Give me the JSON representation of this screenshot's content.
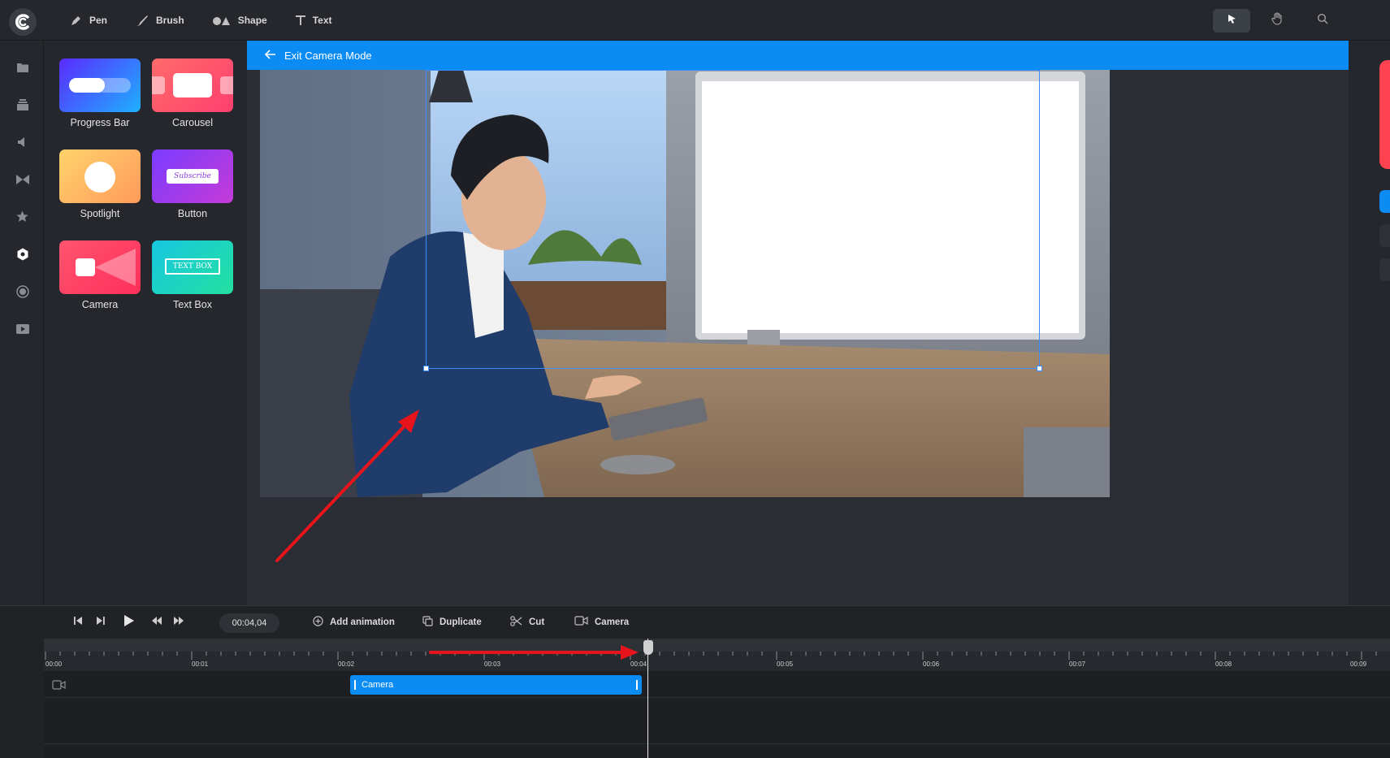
{
  "toolbar": {
    "tools": [
      {
        "label": "Pen",
        "icon": "pen-icon"
      },
      {
        "label": "Brush",
        "icon": "brush-icon"
      },
      {
        "label": "Shape",
        "icon": "shape-icon"
      },
      {
        "label": "Text",
        "icon": "text-icon"
      }
    ],
    "right_tools": [
      "select-icon",
      "hand-icon",
      "search-icon"
    ]
  },
  "rail": [
    "folder-icon",
    "layers-icon",
    "audio-icon",
    "transition-icon",
    "star-icon",
    "widget-icon",
    "record-icon",
    "video-icon"
  ],
  "assets": [
    {
      "label": "Progress Bar"
    },
    {
      "label": "Carousel"
    },
    {
      "label": "Spotlight"
    },
    {
      "label": "Button",
      "thumb_text": "Subscribe"
    },
    {
      "label": "Camera"
    },
    {
      "label": "Text Box",
      "thumb_text": "TEXT BOX"
    }
  ],
  "stage": {
    "exit_label": "Exit Camera Mode"
  },
  "timeline": {
    "timecode": "00:04,04",
    "actions": [
      {
        "label": "Add animation",
        "icon": "plus-circle-icon"
      },
      {
        "label": "Duplicate",
        "icon": "duplicate-icon"
      },
      {
        "label": "Cut",
        "icon": "scissors-icon"
      },
      {
        "label": "Camera",
        "icon": "camera-icon"
      }
    ],
    "ticks": [
      "00:00",
      "00:01",
      "00:02",
      "00:03",
      "00:04",
      "00:05",
      "00:06",
      "00:07",
      "00:08",
      "00:09"
    ],
    "clip_label": "Camera",
    "playhead_time": "00:04,04"
  },
  "colors": {
    "accent": "#0b8cf5",
    "annotation": "#e8141b"
  }
}
